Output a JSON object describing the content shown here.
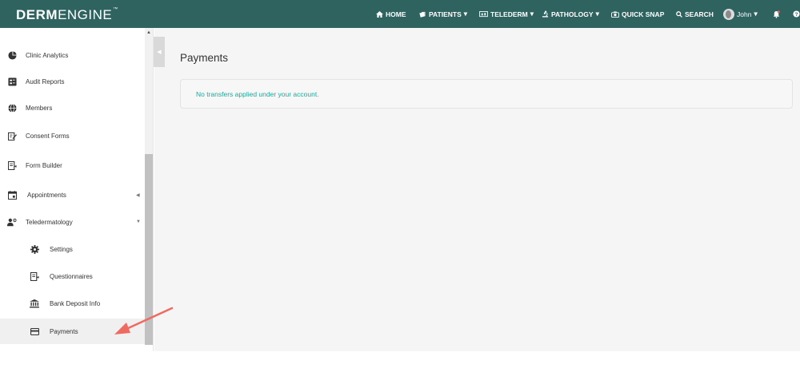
{
  "brand": {
    "bold": "DERM",
    "light": "ENGINE",
    "tm": "™"
  },
  "nav": {
    "home": "HOME",
    "patients": "PATIENTS",
    "telederm": "TELEDERM",
    "pathology": "PATHOLOGY",
    "quick_snap": "QUICK SNAP",
    "search": "SEARCH",
    "user": "John"
  },
  "sidebar": {
    "items": [
      {
        "label": "Clinic Analytics",
        "icon": "pie-chart-icon"
      },
      {
        "label": "Audit Reports",
        "icon": "report-icon"
      },
      {
        "label": "Members",
        "icon": "globe-icon"
      },
      {
        "label": "Consent Forms",
        "icon": "edit-form-icon"
      },
      {
        "label": "Form Builder",
        "icon": "form-builder-icon"
      },
      {
        "label": "Appointments",
        "icon": "calendar-icon"
      },
      {
        "label": "Teledermatology",
        "icon": "doctor-icon"
      }
    ],
    "subitems": [
      {
        "label": "Settings",
        "icon": "gear-icon"
      },
      {
        "label": "Questionnaires",
        "icon": "questionnaire-icon"
      },
      {
        "label": "Bank Deposit Info",
        "icon": "bank-icon"
      },
      {
        "label": "Payments",
        "icon": "credit-card-icon",
        "active": true
      }
    ]
  },
  "main": {
    "title": "Payments",
    "notice": "No transfers applied under your account."
  },
  "colors": {
    "topbar": "#2f6360",
    "accent": "#20a89c",
    "arrow": "#ef6b61"
  }
}
